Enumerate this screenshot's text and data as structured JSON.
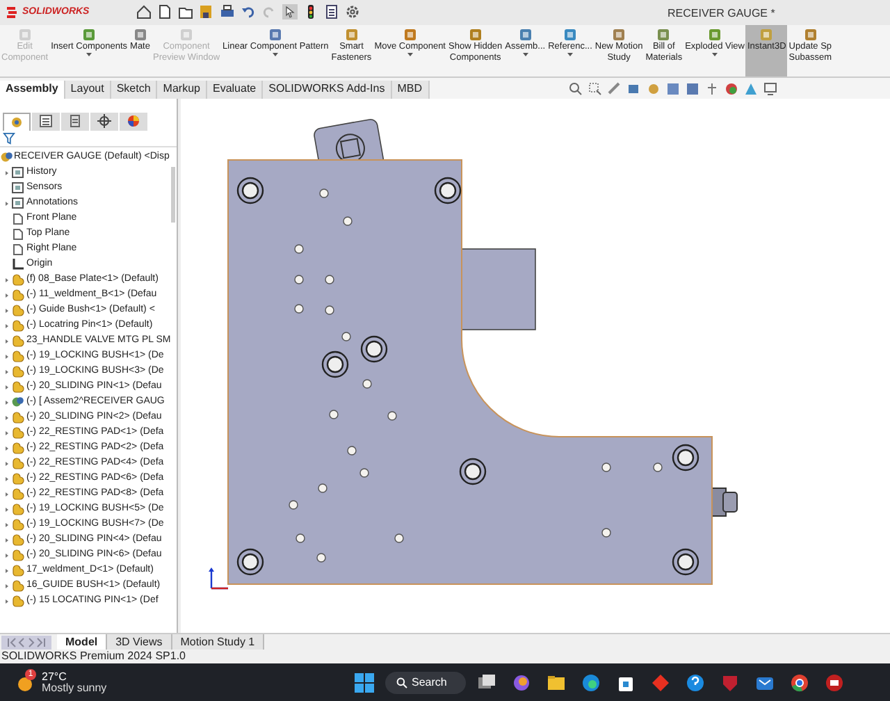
{
  "app": {
    "logo": "SOLIDWORKS",
    "title": "RECEIVER GAUGE *"
  },
  "ribbon": [
    {
      "label": "Edit\nComponent",
      "disabled": true,
      "dropdown": false,
      "selected": false
    },
    {
      "label": "Insert Components",
      "disabled": false,
      "dropdown": true,
      "selected": false
    },
    {
      "label": "Mate",
      "disabled": false,
      "dropdown": false,
      "selected": false
    },
    {
      "label": "Component\nPreview Window",
      "disabled": true,
      "dropdown": false,
      "selected": false
    },
    {
      "label": "Linear Component Pattern",
      "disabled": false,
      "dropdown": true,
      "selected": false
    },
    {
      "label": "Smart\nFasteners",
      "disabled": false,
      "dropdown": false,
      "selected": false
    },
    {
      "label": "Move Component",
      "disabled": false,
      "dropdown": true,
      "selected": false
    },
    {
      "label": "Show Hidden\nComponents",
      "disabled": false,
      "dropdown": false,
      "selected": false
    },
    {
      "label": "Assemb...",
      "disabled": false,
      "dropdown": true,
      "selected": false
    },
    {
      "label": "Referenc...",
      "disabled": false,
      "dropdown": true,
      "selected": false
    },
    {
      "label": "New Motion\nStudy",
      "disabled": false,
      "dropdown": false,
      "selected": false
    },
    {
      "label": "Bill of\nMaterials",
      "disabled": false,
      "dropdown": false,
      "selected": false
    },
    {
      "label": "Exploded View",
      "disabled": false,
      "dropdown": true,
      "selected": false
    },
    {
      "label": "Instant3D",
      "disabled": false,
      "dropdown": false,
      "selected": true
    },
    {
      "label": "Update Sp\nSubassem",
      "disabled": false,
      "dropdown": false,
      "selected": false
    }
  ],
  "tabs": [
    {
      "label": "Assembly",
      "selected": true
    },
    {
      "label": "Layout",
      "selected": false
    },
    {
      "label": "Sketch",
      "selected": false
    },
    {
      "label": "Markup",
      "selected": false
    },
    {
      "label": "Evaluate",
      "selected": false
    },
    {
      "label": "SOLIDWORKS Add-Ins",
      "selected": false
    },
    {
      "label": "MBD",
      "selected": false
    }
  ],
  "panel_tabs": [
    {
      "kind": "tree",
      "selected": true
    },
    {
      "kind": "property",
      "selected": false
    },
    {
      "kind": "config",
      "selected": false
    },
    {
      "kind": "dimxpert",
      "selected": false
    },
    {
      "kind": "display",
      "selected": false
    }
  ],
  "tree": [
    {
      "kind": "assembly",
      "label": "RECEIVER GAUGE (Default) <Disp",
      "expandable": false
    },
    {
      "kind": "folder",
      "label": "History",
      "expandable": true
    },
    {
      "kind": "folder",
      "label": "Sensors",
      "expandable": false
    },
    {
      "kind": "folder",
      "label": "Annotations",
      "expandable": true
    },
    {
      "kind": "plane",
      "label": "Front Plane",
      "expandable": false
    },
    {
      "kind": "plane",
      "label": "Top Plane",
      "expandable": false
    },
    {
      "kind": "plane",
      "label": "Right Plane",
      "expandable": false
    },
    {
      "kind": "origin",
      "label": "Origin",
      "expandable": false
    },
    {
      "kind": "part",
      "label": "(f) 08_Base Plate<1> (Default)",
      "expandable": true
    },
    {
      "kind": "part",
      "label": "(-) 11_weldment_B<1> (Defau",
      "expandable": true
    },
    {
      "kind": "part",
      "label": "(-) Guide Bush<1> (Default) <",
      "expandable": true
    },
    {
      "kind": "part",
      "label": "(-) Locatring Pin<1> (Default)",
      "expandable": true
    },
    {
      "kind": "part",
      "label": "23_HANDLE VALVE MTG PL SM",
      "expandable": true
    },
    {
      "kind": "part",
      "label": "(-) 19_LOCKING BUSH<1> (De",
      "expandable": true
    },
    {
      "kind": "part",
      "label": "(-) 19_LOCKING BUSH<3> (De",
      "expandable": true
    },
    {
      "kind": "part",
      "label": "(-) 20_SLIDING PIN<1> (Defau",
      "expandable": true
    },
    {
      "kind": "subassembly",
      "label": "(-) [ Assem2^RECEIVER GAUG",
      "expandable": true
    },
    {
      "kind": "part",
      "label": "(-) 20_SLIDING PIN<2> (Defau",
      "expandable": true
    },
    {
      "kind": "part",
      "label": "(-) 22_RESTING PAD<1> (Defa",
      "expandable": true
    },
    {
      "kind": "part",
      "label": "(-) 22_RESTING PAD<2> (Defa",
      "expandable": true
    },
    {
      "kind": "part",
      "label": "(-) 22_RESTING PAD<4> (Defa",
      "expandable": true
    },
    {
      "kind": "part",
      "label": "(-) 22_RESTING PAD<6> (Defa",
      "expandable": true
    },
    {
      "kind": "part",
      "label": "(-) 22_RESTING PAD<8> (Defa",
      "expandable": true
    },
    {
      "kind": "part",
      "label": "(-) 19_LOCKING BUSH<5> (De",
      "expandable": true
    },
    {
      "kind": "part",
      "label": "(-) 19_LOCKING BUSH<7> (De",
      "expandable": true
    },
    {
      "kind": "part",
      "label": "(-) 20_SLIDING PIN<4> (Defau",
      "expandable": true
    },
    {
      "kind": "part",
      "label": "(-) 20_SLIDING PIN<6> (Defau",
      "expandable": true
    },
    {
      "kind": "part",
      "label": "17_weldment_D<1> (Default)",
      "expandable": true
    },
    {
      "kind": "part",
      "label": "16_GUIDE BUSH<1> (Default)",
      "expandable": true
    },
    {
      "kind": "part",
      "label": "(-) 15 LOCATING PIN<1> (Def",
      "expandable": true
    }
  ],
  "bottom_tabs": [
    {
      "label": "Model",
      "selected": true
    },
    {
      "label": "3D Views",
      "selected": false
    },
    {
      "label": "Motion Study 1",
      "selected": false
    }
  ],
  "status_bar": "SOLIDWORKS Premium 2024 SP1.0",
  "taskbar": {
    "weather_badge": "1",
    "temperature": "27°C",
    "weather": "Mostly sunny",
    "search": "Search"
  }
}
